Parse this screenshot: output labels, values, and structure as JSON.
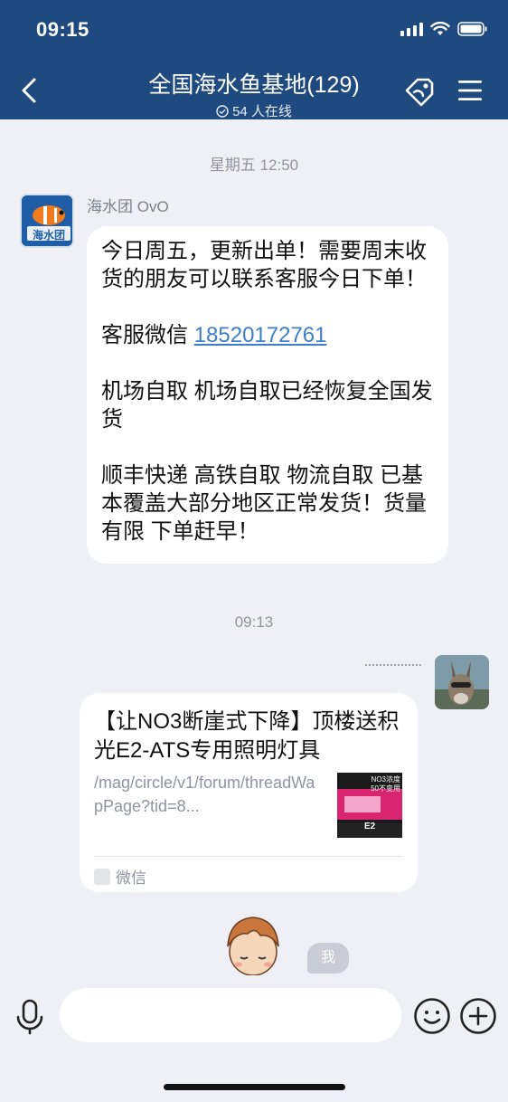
{
  "status_bar": {
    "time": "09:15"
  },
  "header": {
    "title": "全国海水鱼基地(129)",
    "online": "54 人在线"
  },
  "messages": {
    "time_1": "星期五 12:50",
    "sender_name": "海水团 OvO",
    "avatar_text": "海水团",
    "text_part1": "今日周五，更新出单！需要周末收货的朋友可以联系客服今日下单！\n\n客服微信 ",
    "phone": "18520172761",
    "text_part2": "\n\n机场自取 机场自取已经恢复全国发货\n\n顺丰快递 高铁自取 物流自取 已基本覆盖大部分地区正常发货！货量有限  下单赶早！",
    "time_2": "09:13",
    "card": {
      "title": "【让NO3断崖式下降】顶楼送积光E2-ATS专用照明灯具",
      "desc": "/mag/circle/v1/forum/threadWapPage?tid=8...",
      "thumb_line1": "NO3浓度",
      "thumb_line2": "50不变用",
      "thumb_line3": "E2",
      "source": "微信"
    },
    "me_label": "我"
  },
  "input": {
    "placeholder": ""
  },
  "colors": {
    "header_bg": "#1f4a80",
    "chat_bg": "#eef0f5",
    "link": "#3d7fc6"
  }
}
